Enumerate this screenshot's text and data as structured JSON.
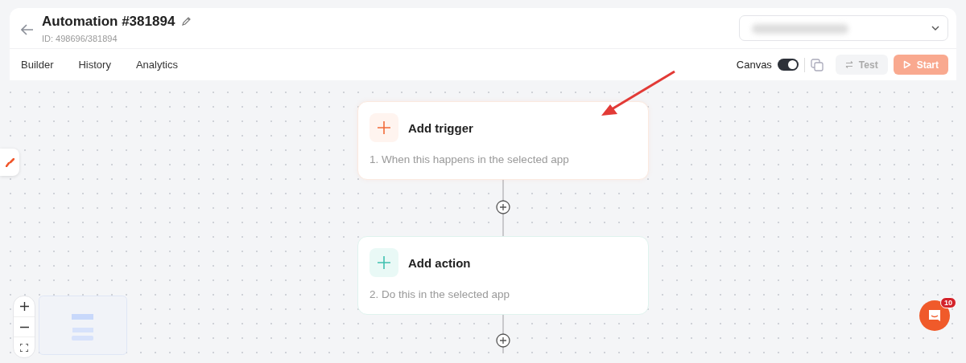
{
  "header": {
    "title": "Automation #381894",
    "id_text": "ID: 498696/381894"
  },
  "tabs": [
    {
      "label": "Builder"
    },
    {
      "label": "History"
    },
    {
      "label": "Analytics"
    }
  ],
  "toolbar": {
    "canvas_label": "Canvas",
    "canvas_on": true,
    "buttons": [
      {
        "kind": "test",
        "label": "Test",
        "disabled": true
      },
      {
        "kind": "start",
        "label": "Start",
        "disabled": true
      }
    ]
  },
  "nodes": [
    {
      "kind": "trigger",
      "title": "Add trigger",
      "subtitle": "1. When this happens in the selected app"
    },
    {
      "kind": "action",
      "title": "Add action",
      "subtitle": "2. Do this in the selected app"
    }
  ],
  "chat": {
    "badge": "10"
  }
}
